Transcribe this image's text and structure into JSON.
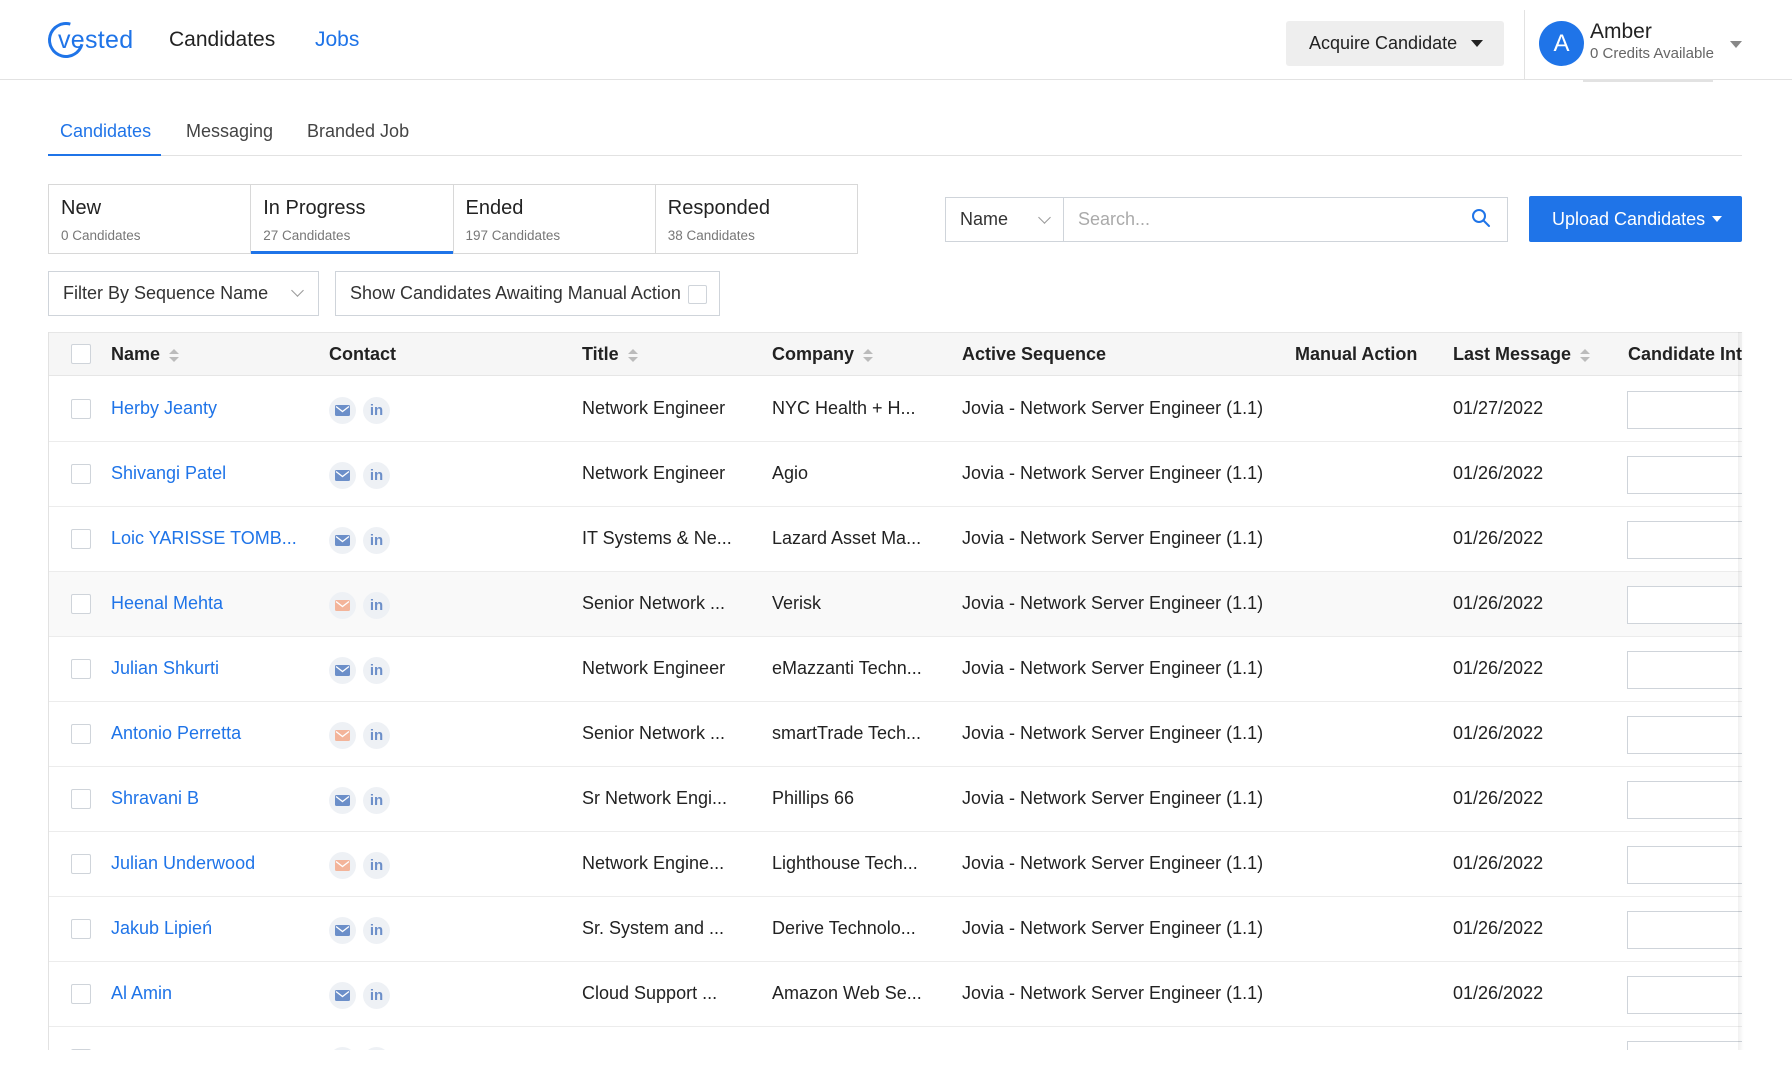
{
  "header": {
    "logo_text": "vested",
    "nav": [
      {
        "label": "Candidates",
        "active": false
      },
      {
        "label": "Jobs",
        "active": true
      }
    ],
    "acquire_label": "Acquire Candidate",
    "user": {
      "initial": "A",
      "name": "Amber",
      "credits": "0 Credits Available"
    }
  },
  "subtabs": [
    {
      "label": "Candidates",
      "active": true
    },
    {
      "label": "Messaging",
      "active": false
    },
    {
      "label": "Branded Job",
      "active": false
    }
  ],
  "status_cards": [
    {
      "label": "New",
      "count": "0 Candidates",
      "active": false
    },
    {
      "label": "In Progress",
      "count": "27 Candidates",
      "active": true
    },
    {
      "label": "Ended",
      "count": "197 Candidates",
      "active": false
    },
    {
      "label": "Responded",
      "count": "38 Candidates",
      "active": false
    }
  ],
  "search": {
    "select_value": "Name",
    "placeholder": "Search..."
  },
  "upload_label": "Upload Candidates",
  "filters": {
    "sequence_placeholder": "Filter By Sequence Name",
    "manual_action_label": "Show Candidates Awaiting Manual Action",
    "manual_action_checked": false
  },
  "table": {
    "columns": [
      "Name",
      "Contact",
      "Title",
      "Company",
      "Active Sequence",
      "Manual Action",
      "Last Message",
      "Candidate Inte"
    ],
    "rows": [
      {
        "name": "Herby Jeanty",
        "email_status": "verified",
        "title": "Network Engineer",
        "company": "NYC Health + H...",
        "sequence": "Jovia - Network Server Engineer (1.1)",
        "manual_action": "",
        "last_message": "01/27/2022"
      },
      {
        "name": "Shivangi Patel",
        "email_status": "verified",
        "title": "Network Engineer",
        "company": "Agio",
        "sequence": "Jovia - Network Server Engineer (1.1)",
        "manual_action": "",
        "last_message": "01/26/2022"
      },
      {
        "name": "Loic YARISSE TOMB...",
        "email_status": "verified",
        "title": "IT Systems & Ne...",
        "company": "Lazard Asset Ma...",
        "sequence": "Jovia - Network Server Engineer (1.1)",
        "manual_action": "",
        "last_message": "01/26/2022"
      },
      {
        "name": "Heenal Mehta",
        "email_status": "unverified",
        "title": "Senior Network ...",
        "company": "Verisk",
        "sequence": "Jovia - Network Server Engineer (1.1)",
        "manual_action": "",
        "last_message": "01/26/2022"
      },
      {
        "name": "Julian Shkurti",
        "email_status": "verified",
        "title": "Network Engineer",
        "company": "eMazzanti Techn...",
        "sequence": "Jovia - Network Server Engineer (1.1)",
        "manual_action": "",
        "last_message": "01/26/2022"
      },
      {
        "name": "Antonio Perretta",
        "email_status": "unverified",
        "title": "Senior Network ...",
        "company": "smartTrade Tech...",
        "sequence": "Jovia - Network Server Engineer (1.1)",
        "manual_action": "",
        "last_message": "01/26/2022"
      },
      {
        "name": "Shravani B",
        "email_status": "verified",
        "title": "Sr Network Engi...",
        "company": "Phillips 66",
        "sequence": "Jovia - Network Server Engineer (1.1)",
        "manual_action": "",
        "last_message": "01/26/2022"
      },
      {
        "name": "Julian Underwood",
        "email_status": "unverified",
        "title": "Network Engine...",
        "company": "Lighthouse Tech...",
        "sequence": "Jovia - Network Server Engineer (1.1)",
        "manual_action": "",
        "last_message": "01/26/2022"
      },
      {
        "name": "Jakub Lipień",
        "email_status": "verified",
        "title": "Sr. System and ...",
        "company": "Derive Technolo...",
        "sequence": "Jovia - Network Server Engineer (1.1)",
        "manual_action": "",
        "last_message": "01/26/2022"
      },
      {
        "name": "Al Amin",
        "email_status": "verified",
        "title": "Cloud Support ...",
        "company": "Amazon Web Se...",
        "sequence": "Jovia - Network Server Engineer (1.1)",
        "manual_action": "",
        "last_message": "01/26/2022"
      },
      {
        "name": "",
        "email_status": "unverified",
        "title": "",
        "company": "",
        "sequence": "",
        "manual_action": "",
        "last_message": ""
      }
    ]
  },
  "colors": {
    "accent": "#1f74e8",
    "email_verified": "#6c8fc9",
    "email_unverified": "#f3b49a",
    "linkedin": "#6c8fc9"
  },
  "icons": {
    "search": "search-icon",
    "email": "mail-icon",
    "linkedin": "linkedin-icon",
    "dropdown": "chevron-down-icon"
  }
}
